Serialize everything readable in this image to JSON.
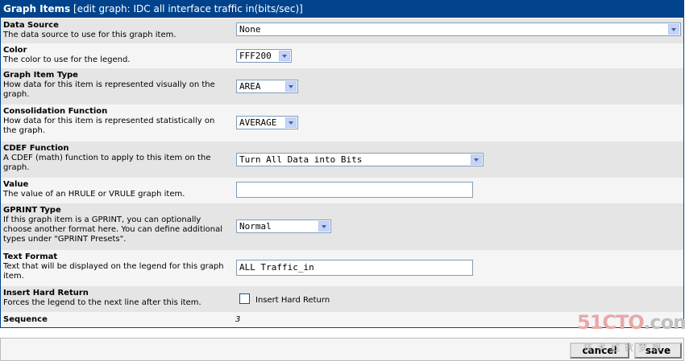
{
  "header": {
    "title": "Graph Items",
    "subtitle": "[edit graph: IDC all interface traffic in(bits/sec)]"
  },
  "fields": {
    "data_source": {
      "title": "Data Source",
      "desc": "The data source to use for this graph item.",
      "value": "None"
    },
    "color": {
      "title": "Color",
      "desc": "The color to use for the legend.",
      "value": "FFF200"
    },
    "item_type": {
      "title": "Graph Item Type",
      "desc": "How data for this item is represented visually on the graph.",
      "value": "AREA"
    },
    "consolidation": {
      "title": "Consolidation Function",
      "desc": "How data for this item is represented statistically on the graph.",
      "value": "AVERAGE"
    },
    "cdef": {
      "title": "CDEF Function",
      "desc": "A CDEF (math) function to apply to this item on the graph.",
      "value": "Turn All Data into Bits"
    },
    "value": {
      "title": "Value",
      "desc": "The value of an HRULE or VRULE graph item.",
      "value": ""
    },
    "gprint": {
      "title": "GPRINT Type",
      "desc": "If this graph item is a GPRINT, you can optionally choose another format here. You can define additional types under \"GPRINT Presets\".",
      "value": "Normal"
    },
    "text_format": {
      "title": "Text Format",
      "desc": "Text that will be displayed on the legend for this graph item.",
      "value": "ALL Traffic_in"
    },
    "hard_return": {
      "title": "Insert Hard Return",
      "desc": "Forces the legend to the next line after this item.",
      "checkbox_label": "Insert Hard Return"
    },
    "sequence": {
      "title": "Sequence",
      "value": "3"
    }
  },
  "buttons": {
    "cancel": "cancel",
    "save": "save"
  },
  "watermark": {
    "brand_a": "51CTO",
    "brand_b": ".com",
    "tagline": "技术成就梦想"
  },
  "colors": {
    "header_bg": "#00438c",
    "row_light": "#f5f5f5",
    "row_dark": "#e5e5e5"
  }
}
